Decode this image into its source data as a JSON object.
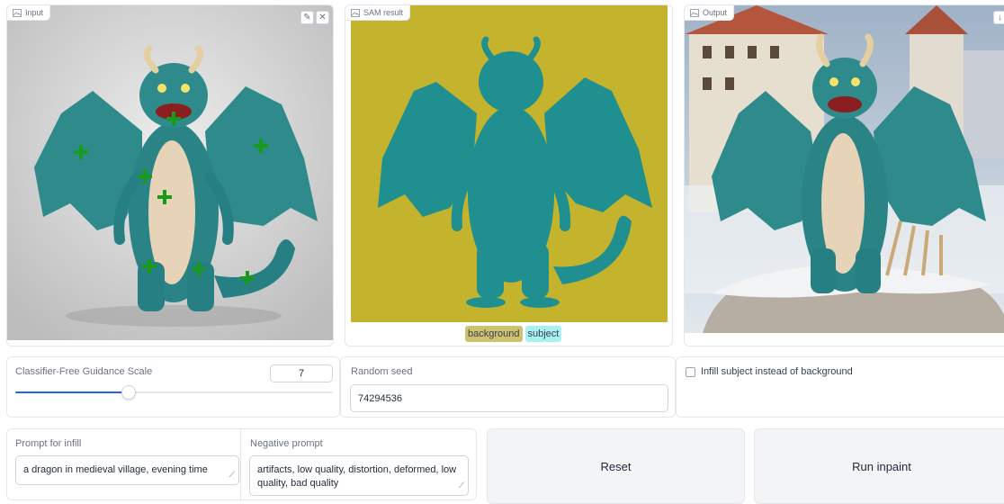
{
  "colors": {
    "sam_background": "#c4b32c",
    "sam_subject": "#1f8f90",
    "legend_background": "#cfc26f",
    "legend_subject": "#a8f0f2",
    "point_marker": "#1a9a1a",
    "slider_accent": "#2563eb"
  },
  "input_panel": {
    "label": "Input",
    "label_icon": "image-icon",
    "edit_icon": "pencil-icon",
    "clear_icon": "close-icon",
    "image": "cartoon teal dragon on grey background with green point markers",
    "point_marker_icon": "plus-icon"
  },
  "sam_panel": {
    "label": "SAM result",
    "label_icon": "image-icon",
    "image": "segmentation mask of dragon (teal) on olive background",
    "legend": [
      "background",
      "subject"
    ]
  },
  "output_panel": {
    "label": "Output",
    "label_icon": "image-icon",
    "download_icon": "download-icon",
    "image": "teal dragon standing on snowy rock in front of medieval village"
  },
  "controls": {
    "cfg_label": "Classifier-Free Guidance Scale",
    "cfg_value": "7",
    "cfg_level": 0.25,
    "seed_label": "Random seed",
    "seed_value": "74294536",
    "infill_checkbox_label": "Infill subject instead of background",
    "infill_checked": false
  },
  "prompts": {
    "prompt_label": "Prompt for infill",
    "prompt_value": "a dragon in medieval village, evening time",
    "negative_label": "Negative prompt",
    "negative_value": "artifacts, low quality, distortion, deformed, low quality, bad quality"
  },
  "buttons": {
    "reset": "Reset",
    "run": "Run inpaint"
  }
}
